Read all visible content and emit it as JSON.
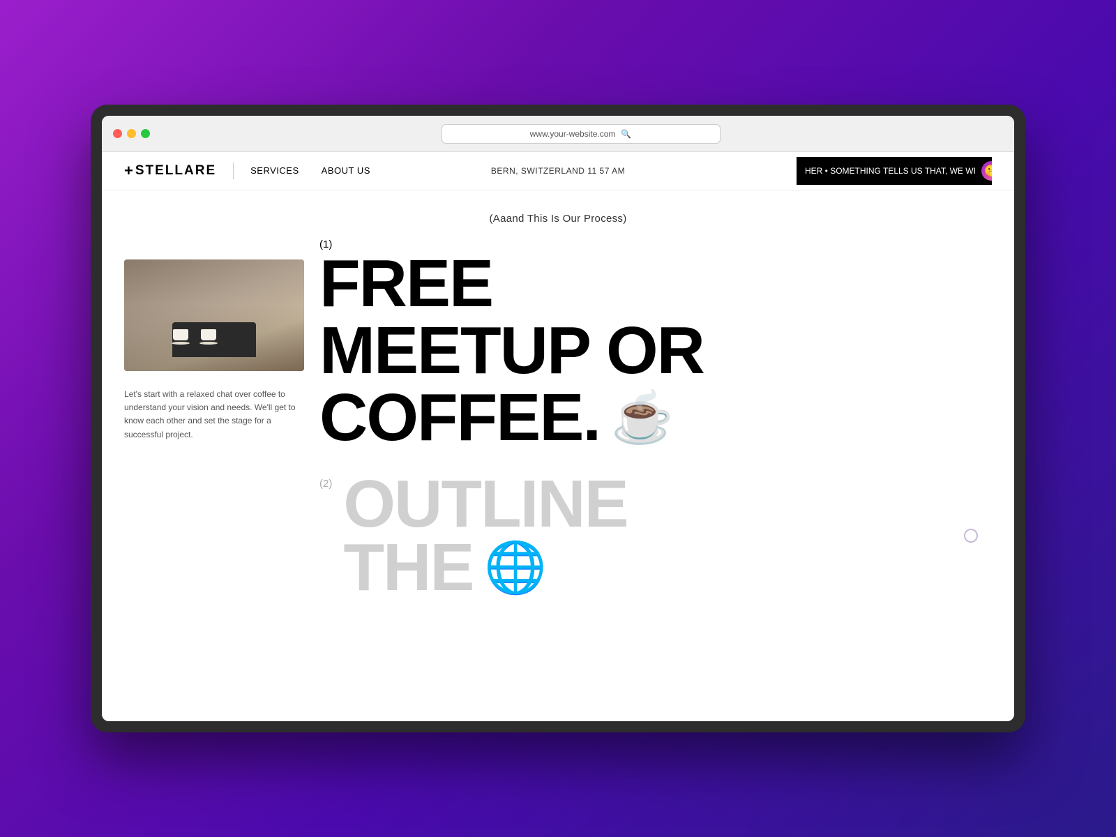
{
  "background": {
    "gradient_start": "#9b1fcc",
    "gradient_end": "#2a1a8a"
  },
  "browser": {
    "url": "www.your-website.com",
    "search_icon": "🔍"
  },
  "nav": {
    "logo": "+STELLARE",
    "logo_plus": "+",
    "logo_name": "STELLARE",
    "links": [
      "SERVICES",
      "ABOUT US"
    ],
    "center_text": "BERN, SWITZERLAND 11 57 AM",
    "ticker_text": "HER • SOMETHING TELLS US THAT, WE WI",
    "ticker_emoji": "🤫"
  },
  "main": {
    "subtitle": "(Aaand This Is Our Process)",
    "step1": {
      "number": "(1)",
      "line1": "FREE",
      "line2": "MEETUP OR",
      "line3": "COFFEE.",
      "emoji": "☕",
      "description": "Let's start with a relaxed chat over coffee to understand your vision and needs. We'll get to know each other and set the stage for a successful project."
    },
    "step2": {
      "number": "(2)",
      "line1": "OUTLINE",
      "line2": "THE",
      "emoji": "🌐"
    }
  }
}
